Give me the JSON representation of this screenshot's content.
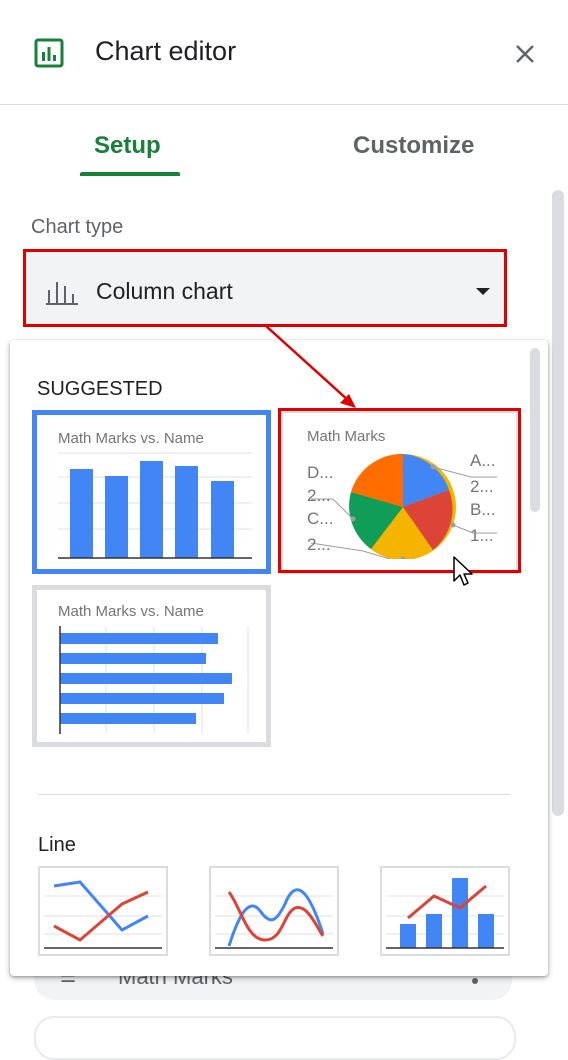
{
  "header": {
    "title": "Chart editor",
    "logo_icon": "chart-logo-icon",
    "close_icon": "close-icon"
  },
  "tabs": [
    {
      "label": "Setup",
      "active": true
    },
    {
      "label": "Customize",
      "active": false
    }
  ],
  "chart_type": {
    "label": "Chart type",
    "value": "Column chart",
    "icon": "column-chart-icon"
  },
  "dropdown": {
    "suggested_title": "SUGGESTED",
    "suggested": [
      {
        "type": "column",
        "title": "Math Marks vs. Name",
        "selected": true
      },
      {
        "type": "pie",
        "title": "Math Marks",
        "labels": [
          "D...",
          "2...",
          "C...",
          "2...",
          "A...",
          "2...",
          "B...",
          "1..."
        ]
      },
      {
        "type": "bar",
        "title": "Math Marks vs. Name"
      }
    ],
    "line_title": "Line"
  },
  "behind": {
    "label": "Math Marks"
  },
  "colors": {
    "accent": "#188038",
    "blue": "#4285f4",
    "red": "#db4437",
    "yellow": "#f4b400",
    "green": "#0f9d58",
    "orange": "#ff6d00",
    "highlight": "#e00000"
  }
}
